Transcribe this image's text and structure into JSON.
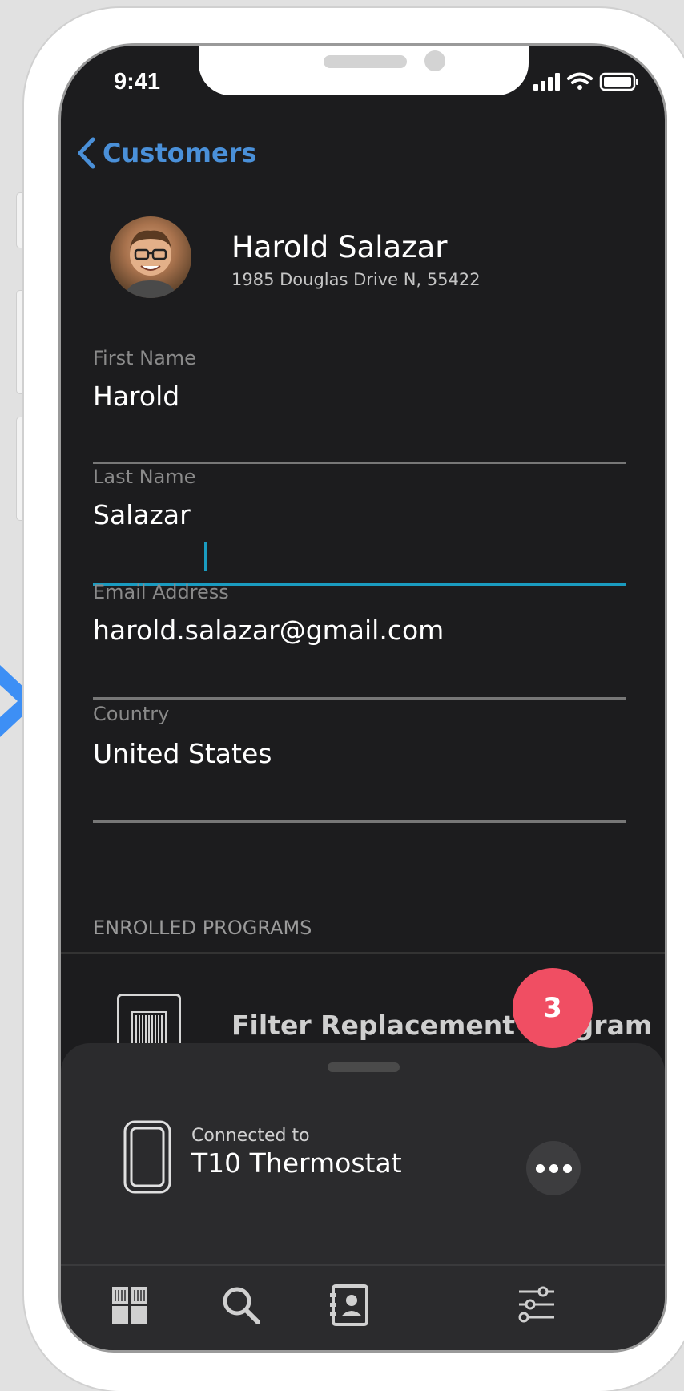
{
  "status_bar": {
    "time": "9:41"
  },
  "nav": {
    "back_label": "Customers"
  },
  "customer": {
    "name": "Harold Salazar",
    "address": "1985 Douglas Drive N, 55422"
  },
  "form": {
    "first_name": {
      "label": "First Name",
      "value": "Harold"
    },
    "last_name": {
      "label": "Last Name",
      "value": "Salazar"
    },
    "email": {
      "label": "Email Address",
      "value": "harold.salazar@gmail.com"
    },
    "country": {
      "label": "Country",
      "value": "United States"
    }
  },
  "programs": {
    "header": "ENROLLED PROGRAMS",
    "items": [
      {
        "label": "Filter Replacement Program"
      }
    ]
  },
  "device_sheet": {
    "connected_label": "Connected to",
    "device_name": "T10 Thermostat"
  },
  "badge": {
    "count": "3"
  },
  "tab_bar": {
    "icons": [
      "dashboard-icon",
      "search-icon",
      "contacts-icon",
      "settings-sliders-icon"
    ]
  },
  "colors": {
    "accent": "#4a90d9",
    "active_field": "#1a9bc0",
    "badge": "#f04e63",
    "background": "#1c1c1e"
  }
}
